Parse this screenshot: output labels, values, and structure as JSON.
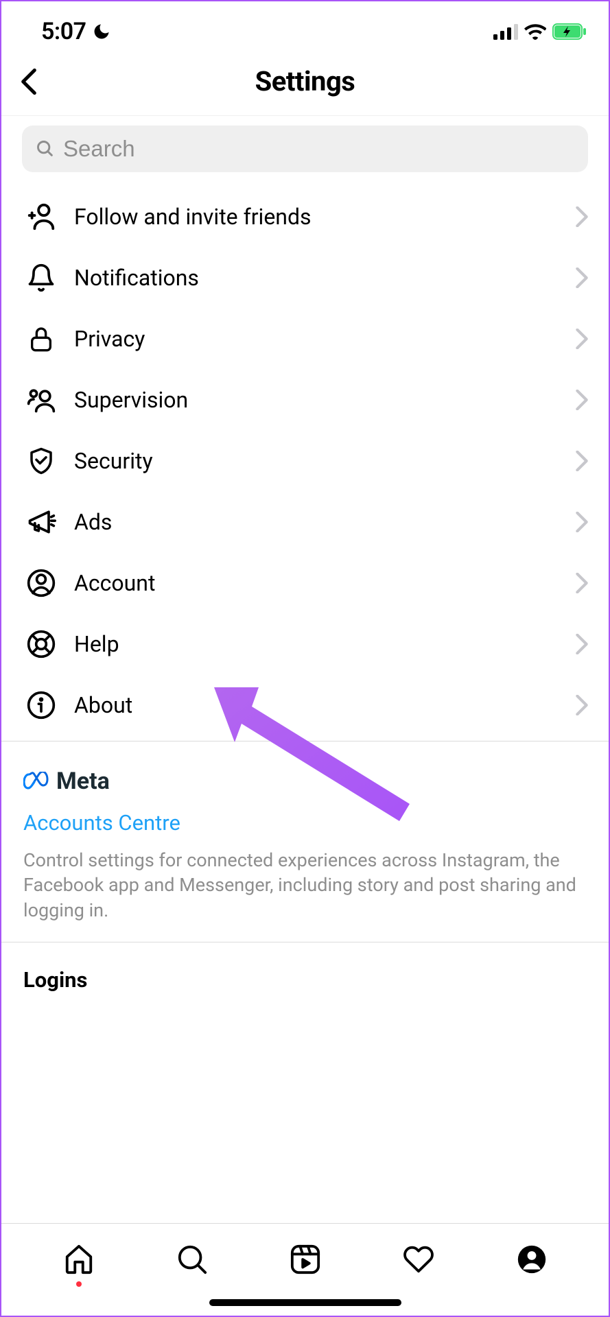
{
  "status": {
    "time": "5:07"
  },
  "header": {
    "title": "Settings"
  },
  "search": {
    "placeholder": "Search"
  },
  "menu": {
    "items": [
      {
        "label": "Follow and invite friends",
        "icon": "add-user"
      },
      {
        "label": "Notifications",
        "icon": "bell"
      },
      {
        "label": "Privacy",
        "icon": "lock"
      },
      {
        "label": "Supervision",
        "icon": "people"
      },
      {
        "label": "Security",
        "icon": "shield"
      },
      {
        "label": "Ads",
        "icon": "megaphone"
      },
      {
        "label": "Account",
        "icon": "user-circle"
      },
      {
        "label": "Help",
        "icon": "help-ring"
      },
      {
        "label": "About",
        "icon": "info"
      }
    ]
  },
  "meta": {
    "brand": "Meta",
    "link": "Accounts Centre",
    "description": "Control settings for connected experiences across Instagram, the Facebook app and Messenger, including story and post sharing and logging in."
  },
  "logins": {
    "title": "Logins"
  },
  "annotation": {
    "color": "#a855f7"
  }
}
